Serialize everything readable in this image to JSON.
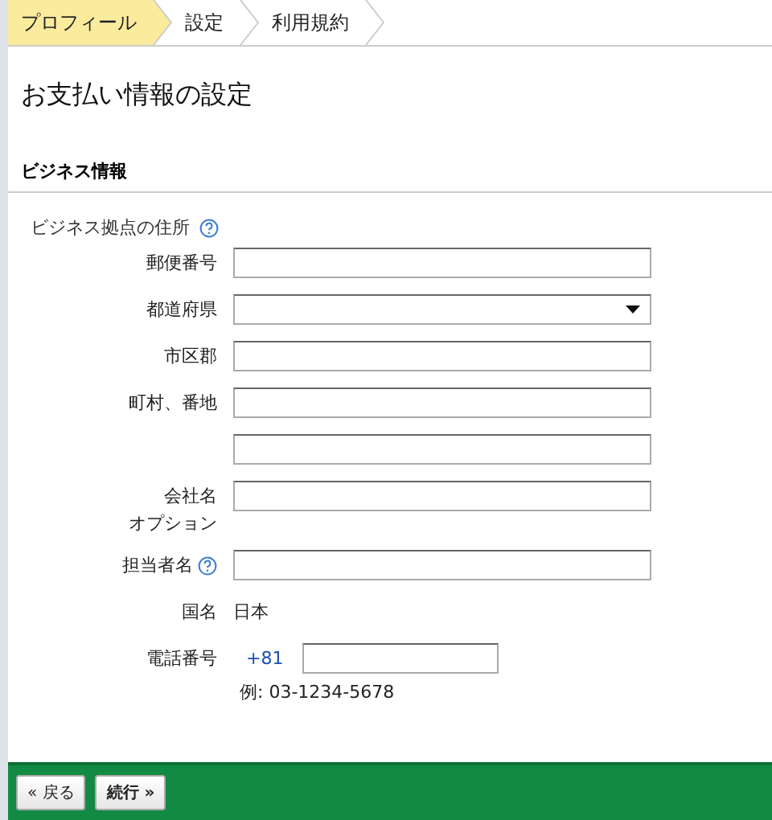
{
  "steps": [
    {
      "label": "プロフィール",
      "selected": true
    },
    {
      "label": "設定",
      "selected": false
    },
    {
      "label": "利用規約",
      "selected": false
    }
  ],
  "title": "お支払い情報の設定",
  "section": "ビジネス情報",
  "address_heading": {
    "label": "ビジネス拠点の住所",
    "help": true
  },
  "fields": [
    {
      "kind": "text",
      "label": [
        "郵便番号"
      ],
      "help": false
    },
    {
      "kind": "select",
      "label": [
        "都道府県"
      ],
      "help": false
    },
    {
      "kind": "text",
      "label": [
        "市区郡"
      ],
      "help": false
    },
    {
      "kind": "text",
      "label": [
        "町村、番地"
      ],
      "help": false
    },
    {
      "kind": "text",
      "help": false
    },
    {
      "kind": "text",
      "label": [
        "会社名",
        "オプション"
      ],
      "help": false
    },
    {
      "kind": "text",
      "label": [
        "担当者名"
      ],
      "help": true
    }
  ],
  "country": {
    "label": "国名",
    "value": "日本"
  },
  "phone": {
    "label": "電話番号",
    "prefix": "+81",
    "example": "例: 03-1234-5678"
  },
  "buttons": [
    {
      "label": "« 戻る",
      "bold": false
    },
    {
      "label": "続行 »",
      "bold": true
    }
  ]
}
